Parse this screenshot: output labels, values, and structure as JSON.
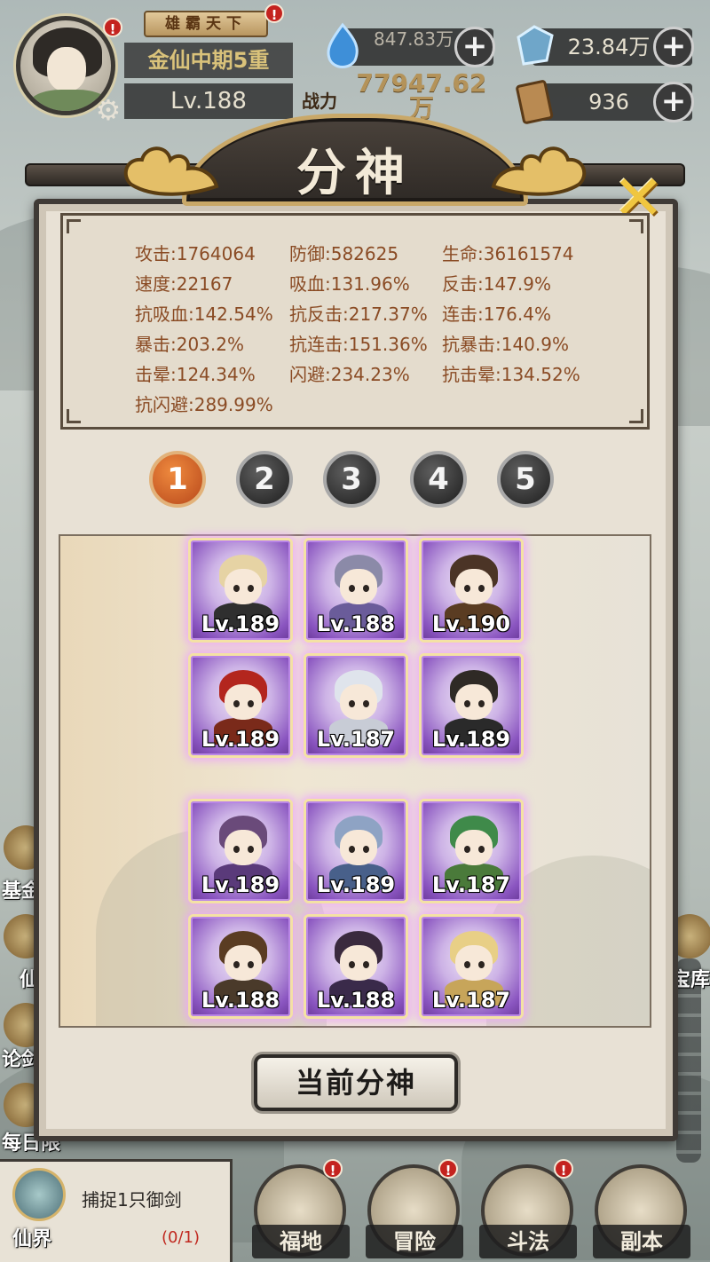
{
  "player": {
    "title_badge": "雄霸天下",
    "realm": "金仙中期5重",
    "level": "Lv.188",
    "avatar_alert": "!"
  },
  "resources": {
    "spirit": "847.83万",
    "jade": "23.84万",
    "scroll": "936",
    "power_label": "战力",
    "power_value": "77947.62万"
  },
  "modal": {
    "title": "分神",
    "stats": [
      {
        "label": "攻击",
        "value": "1764064"
      },
      {
        "label": "防御",
        "value": "582625"
      },
      {
        "label": "生命",
        "value": "36161574"
      },
      {
        "label": "速度",
        "value": "22167"
      },
      {
        "label": "吸血",
        "value": "131.96%"
      },
      {
        "label": "反击",
        "value": "147.9%"
      },
      {
        "label": "抗吸血",
        "value": "142.54%"
      },
      {
        "label": "抗反击",
        "value": "217.37%"
      },
      {
        "label": "连击",
        "value": "176.4%"
      },
      {
        "label": "暴击",
        "value": "203.2%"
      },
      {
        "label": "抗连击",
        "value": "151.36%"
      },
      {
        "label": "抗暴击",
        "value": "140.9%"
      },
      {
        "label": "击晕",
        "value": "124.34%"
      },
      {
        "label": "闪避",
        "value": "234.23%"
      },
      {
        "label": "抗击晕",
        "value": "134.52%"
      },
      {
        "label": "抗闪避",
        "value": "289.99%"
      }
    ],
    "tabs": [
      "1",
      "2",
      "3",
      "4",
      "5"
    ],
    "active_tab": "1",
    "heroes": [
      {
        "level": "Lv.189"
      },
      {
        "level": "Lv.188"
      },
      {
        "level": "Lv.190"
      },
      {
        "level": "Lv.189"
      },
      {
        "level": "Lv.187"
      },
      {
        "level": "Lv.189"
      },
      {
        "level": "Lv.189"
      },
      {
        "level": "Lv.189"
      },
      {
        "level": "Lv.187"
      },
      {
        "level": "Lv.188"
      },
      {
        "level": "Lv.188"
      },
      {
        "level": "Lv.187"
      }
    ],
    "current_button": "当前分神"
  },
  "side_left": [
    "基金",
    "仙",
    "论剑",
    "每日限"
  ],
  "side_right": [
    "宝库"
  ],
  "quest": {
    "realm_label": "仙界",
    "task": "捕捉1只御剑",
    "progress": "(0/1)"
  },
  "bottom_nav": [
    "福地",
    "冒险",
    "斗法",
    "副本"
  ],
  "colors": {
    "accent_orange": "#d4602a",
    "stat_text": "#8a4b24",
    "card_purple": "#8a55c0",
    "alert_red": "#c4231f"
  }
}
